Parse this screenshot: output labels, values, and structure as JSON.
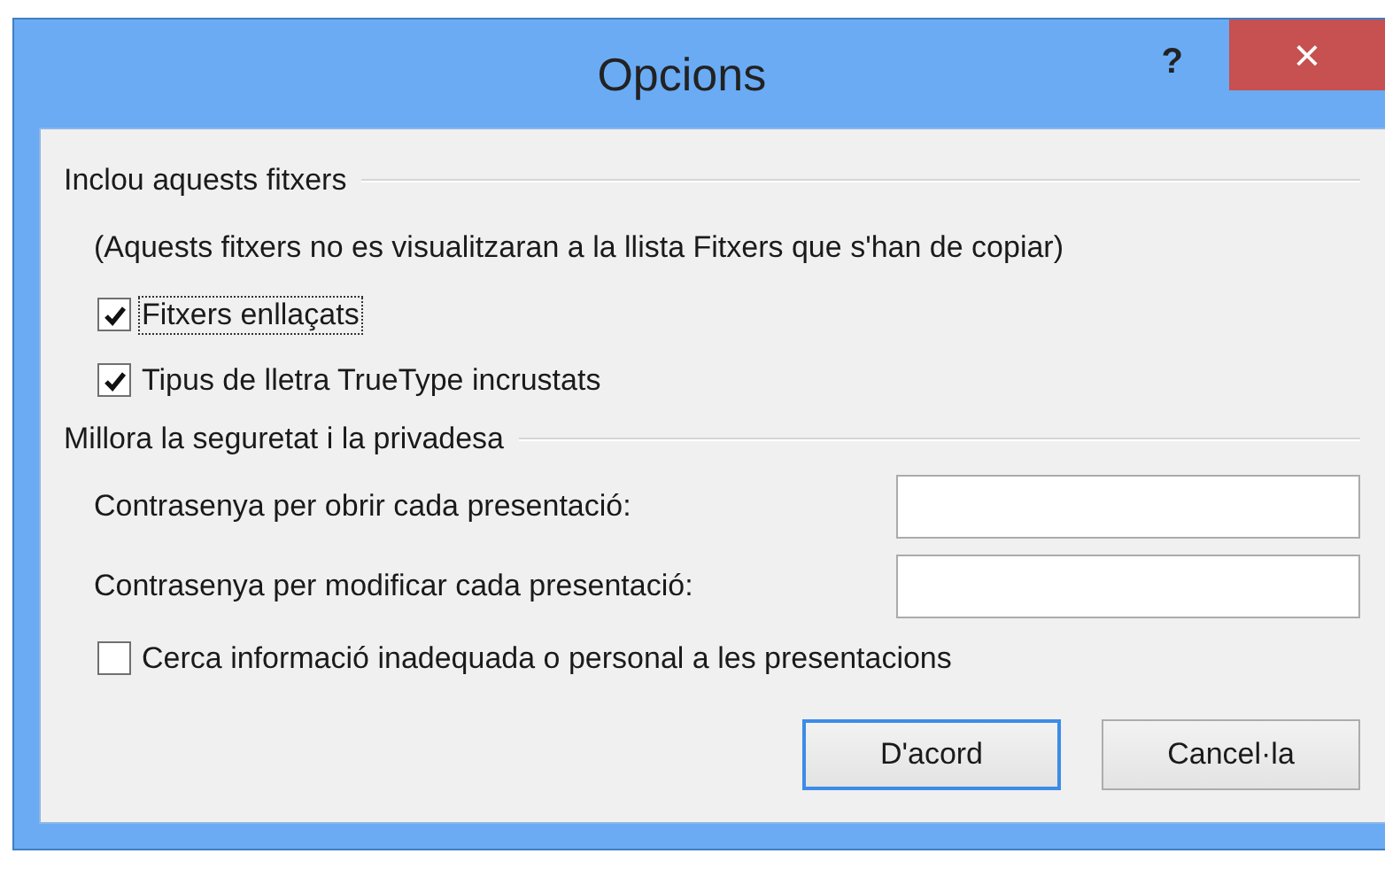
{
  "window": {
    "title": "Opcions",
    "help": "?",
    "close": "×"
  },
  "groups": [
    {
      "title": "Inclou aquests fitxers",
      "items": [
        {
          "kind": "note",
          "text": "(Aquests fitxers no es visualitzaran a la llista Fitxers que s'han de copiar)"
        },
        {
          "kind": "checkbox",
          "label": "Fitxers enllaçats",
          "checked": true,
          "focused": true
        },
        {
          "kind": "checkbox",
          "label": "Tipus de lletra TrueType incrustats",
          "checked": true,
          "focused": false
        }
      ]
    },
    {
      "title": "Millora la seguretat i la privadesa",
      "items": [
        {
          "kind": "field",
          "label": "Contrasenya per obrir cada presentació:"
        },
        {
          "kind": "field",
          "label": "Contrasenya per modificar cada presentació:"
        },
        {
          "kind": "checkbox",
          "label": "Cerca informació inadequada o personal a les presentacions",
          "checked": false,
          "focused": false
        }
      ]
    }
  ],
  "buttons": [
    {
      "label": "D'acord",
      "default": true
    },
    {
      "label": "Cancel·la",
      "default": false
    }
  ]
}
